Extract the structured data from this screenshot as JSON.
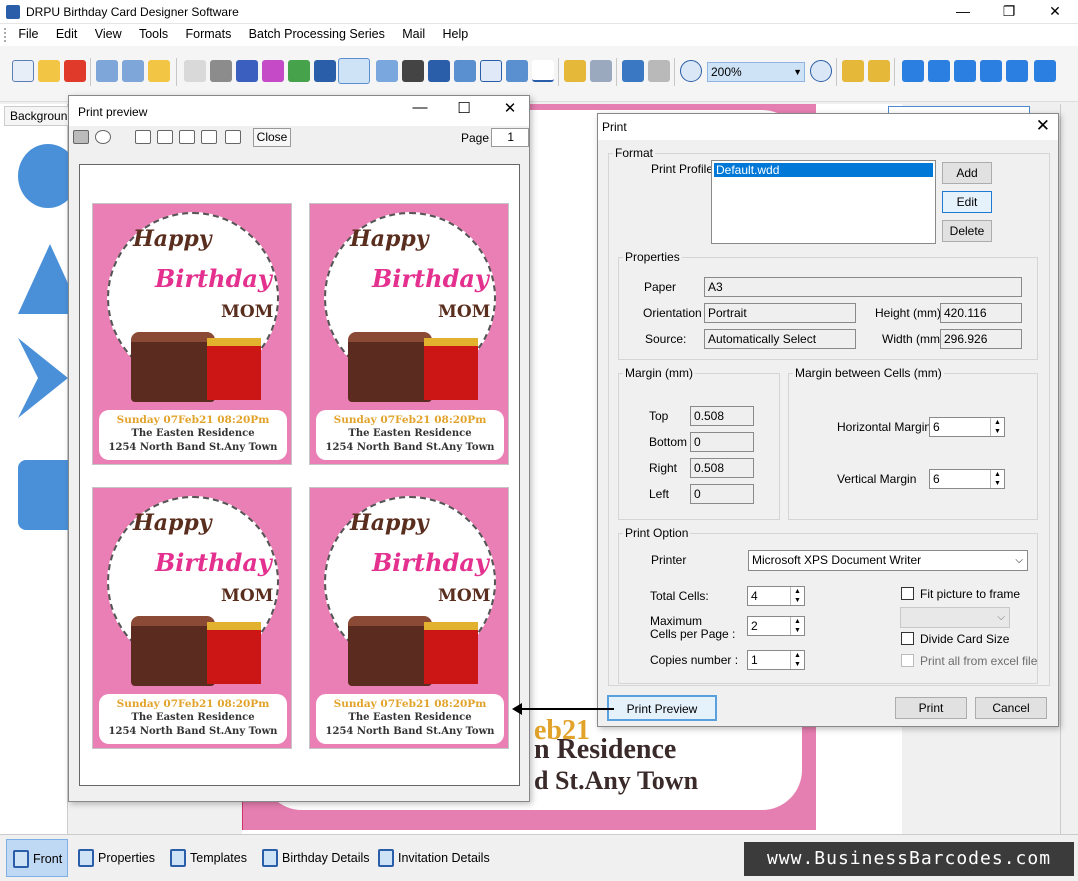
{
  "app": {
    "title": "DRPU Birthday Card Designer Software",
    "controls": {
      "minimize": "—",
      "restore": "❐",
      "close": "✕"
    }
  },
  "menu": [
    "File",
    "Edit",
    "View",
    "Tools",
    "Formats",
    "Batch Processing Series",
    "Mail",
    "Help"
  ],
  "toolbar": {
    "zoom": "200%"
  },
  "left_panel": {
    "tab_label": "Backgroun"
  },
  "canvas": {
    "partial_line_1": "eb21",
    "partial_line_2": "n Residence",
    "partial_line_3": "d St.Any Town"
  },
  "print_preview": {
    "title": "Print preview",
    "close_label": "Close",
    "page_label": "Page",
    "page_value": "1",
    "card": {
      "line1": "Happy",
      "line2": "Birthday",
      "line3": "MOM",
      "date": "Sunday 07Feb21  08:20Pm",
      "venue": "The Easten Residence",
      "address": "1254 North Band St.Any Town"
    }
  },
  "print_dialog": {
    "title": "Print",
    "format_legend": "Format",
    "print_profile_label": "Print Profile",
    "print_profile_selected": "Default.wdd",
    "add_label": "Add",
    "edit_label": "Edit",
    "delete_label": "Delete",
    "properties_legend": "Properties",
    "paper_label": "Paper",
    "paper_value": "A3",
    "orientation_label": "Orientation",
    "orientation_value": "Portrait",
    "source_label": "Source:",
    "source_value": "Automatically Select",
    "height_label": "Height (mm)",
    "height_value": "420.116",
    "width_label": "Width (mm)",
    "width_value": "296.926",
    "margin_legend": "Margin (mm)",
    "top_label": "Top",
    "top_value": "0.508",
    "bottom_label": "Bottom",
    "bottom_value": "0",
    "right_label": "Right",
    "right_value": "0.508",
    "left_label": "Left",
    "left_value": "0",
    "cells_margin_legend": "Margin between Cells (mm)",
    "horizontal_margin_label": "Horizontal Margin",
    "horizontal_margin_value": "6",
    "vertical_margin_label": "Vertical Margin",
    "vertical_margin_value": "6",
    "print_option_legend": "Print Option",
    "printer_label": "Printer",
    "printer_value": "Microsoft XPS Document Writer",
    "total_cells_label": "Total Cells:",
    "total_cells_value": "4",
    "max_cells_label_1": "Maximum",
    "max_cells_label_2": "Cells per Page :",
    "max_cells_value": "2",
    "copies_label": "Copies number :",
    "copies_value": "1",
    "fit_picture_label": "Fit picture to frame",
    "divide_card_label": "Divide Card Size",
    "print_all_label": "Print all from excel file",
    "print_preview_button": "Print Preview",
    "print_button": "Print",
    "cancel_button": "Cancel"
  },
  "bottom_tabs": [
    "Front",
    "Properties",
    "Templates",
    "Birthday Details",
    "Invitation Details"
  ],
  "brand": "www.BusinessBarcodes.com"
}
